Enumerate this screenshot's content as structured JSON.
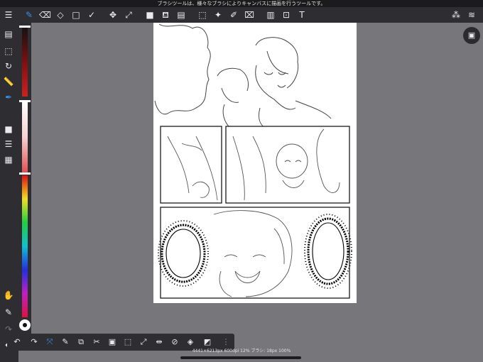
{
  "hint_text": "ブラシツールは、様々なブラシによりキャンバスに描画を行うツールです。",
  "top_toolbar": {
    "menu_icon": "☰",
    "tools": [
      {
        "name": "brush",
        "glyph": "✎"
      },
      {
        "name": "eraser",
        "glyph": "⌫"
      },
      {
        "name": "blur",
        "glyph": "◇"
      },
      {
        "name": "rectangle",
        "glyph": "□"
      },
      {
        "name": "check-select",
        "glyph": "✓"
      },
      {
        "name": "move",
        "glyph": "✥"
      },
      {
        "name": "transform",
        "glyph": "⤢"
      },
      {
        "name": "fill-swatch",
        "glyph": "■"
      },
      {
        "name": "bucket",
        "glyph": "⛾"
      },
      {
        "name": "gradient",
        "glyph": "▤"
      },
      {
        "name": "lasso-select",
        "glyph": "⬚"
      },
      {
        "name": "magic-wand",
        "glyph": "✦"
      },
      {
        "name": "select-pen",
        "glyph": "✐"
      },
      {
        "name": "select-eraser",
        "glyph": "⌧"
      },
      {
        "name": "frame-divide",
        "glyph": "▥"
      },
      {
        "name": "crop",
        "glyph": "⊡"
      },
      {
        "name": "text",
        "glyph": "T"
      }
    ],
    "right_icons": [
      {
        "name": "materials",
        "glyph": "⁂"
      },
      {
        "name": "layers",
        "glyph": "≋"
      }
    ]
  },
  "left_toolbar": {
    "icons": [
      {
        "name": "pages",
        "glyph": "▤"
      },
      {
        "name": "selection-layer",
        "glyph": "⬚"
      },
      {
        "name": "rotate",
        "glyph": "↻"
      },
      {
        "name": "ruler",
        "glyph": "📏"
      },
      {
        "name": "eyedropper",
        "glyph": "✒"
      },
      {
        "name": "color-swatch",
        "glyph": "■"
      },
      {
        "name": "brush-size",
        "glyph": "☰"
      },
      {
        "name": "opacity",
        "glyph": "▦"
      },
      {
        "name": "hand",
        "glyph": "✋"
      },
      {
        "name": "pen",
        "glyph": "✎"
      },
      {
        "name": "redo",
        "glyph": "↷"
      },
      {
        "name": "back",
        "glyph": "⬅"
      }
    ]
  },
  "bottom_toolbar": {
    "icons": [
      {
        "name": "undo",
        "glyph": "↶"
      },
      {
        "name": "redo",
        "glyph": "↷"
      },
      {
        "name": "transform-select",
        "glyph": "⤧"
      },
      {
        "name": "select-pen",
        "glyph": "✎"
      },
      {
        "name": "copy",
        "glyph": "⧉"
      },
      {
        "name": "cut",
        "glyph": "✂"
      },
      {
        "name": "paste",
        "glyph": "▣"
      },
      {
        "name": "select-all",
        "glyph": "⬚"
      },
      {
        "name": "transform",
        "glyph": "⤢"
      },
      {
        "name": "flip",
        "glyph": "⇹"
      },
      {
        "name": "deselect",
        "glyph": "⊘"
      },
      {
        "name": "fill-selection",
        "glyph": "◈"
      },
      {
        "name": "stroke",
        "glyph": "◩"
      },
      {
        "name": "more",
        "glyph": "⋮"
      }
    ]
  },
  "status_text": "4441×6213px 600dpi 12% ブラシ: 18px 100%",
  "colors": {
    "accent": "#3d8be8",
    "toolbar": "#2e2e32",
    "workspace": "#76767b"
  }
}
